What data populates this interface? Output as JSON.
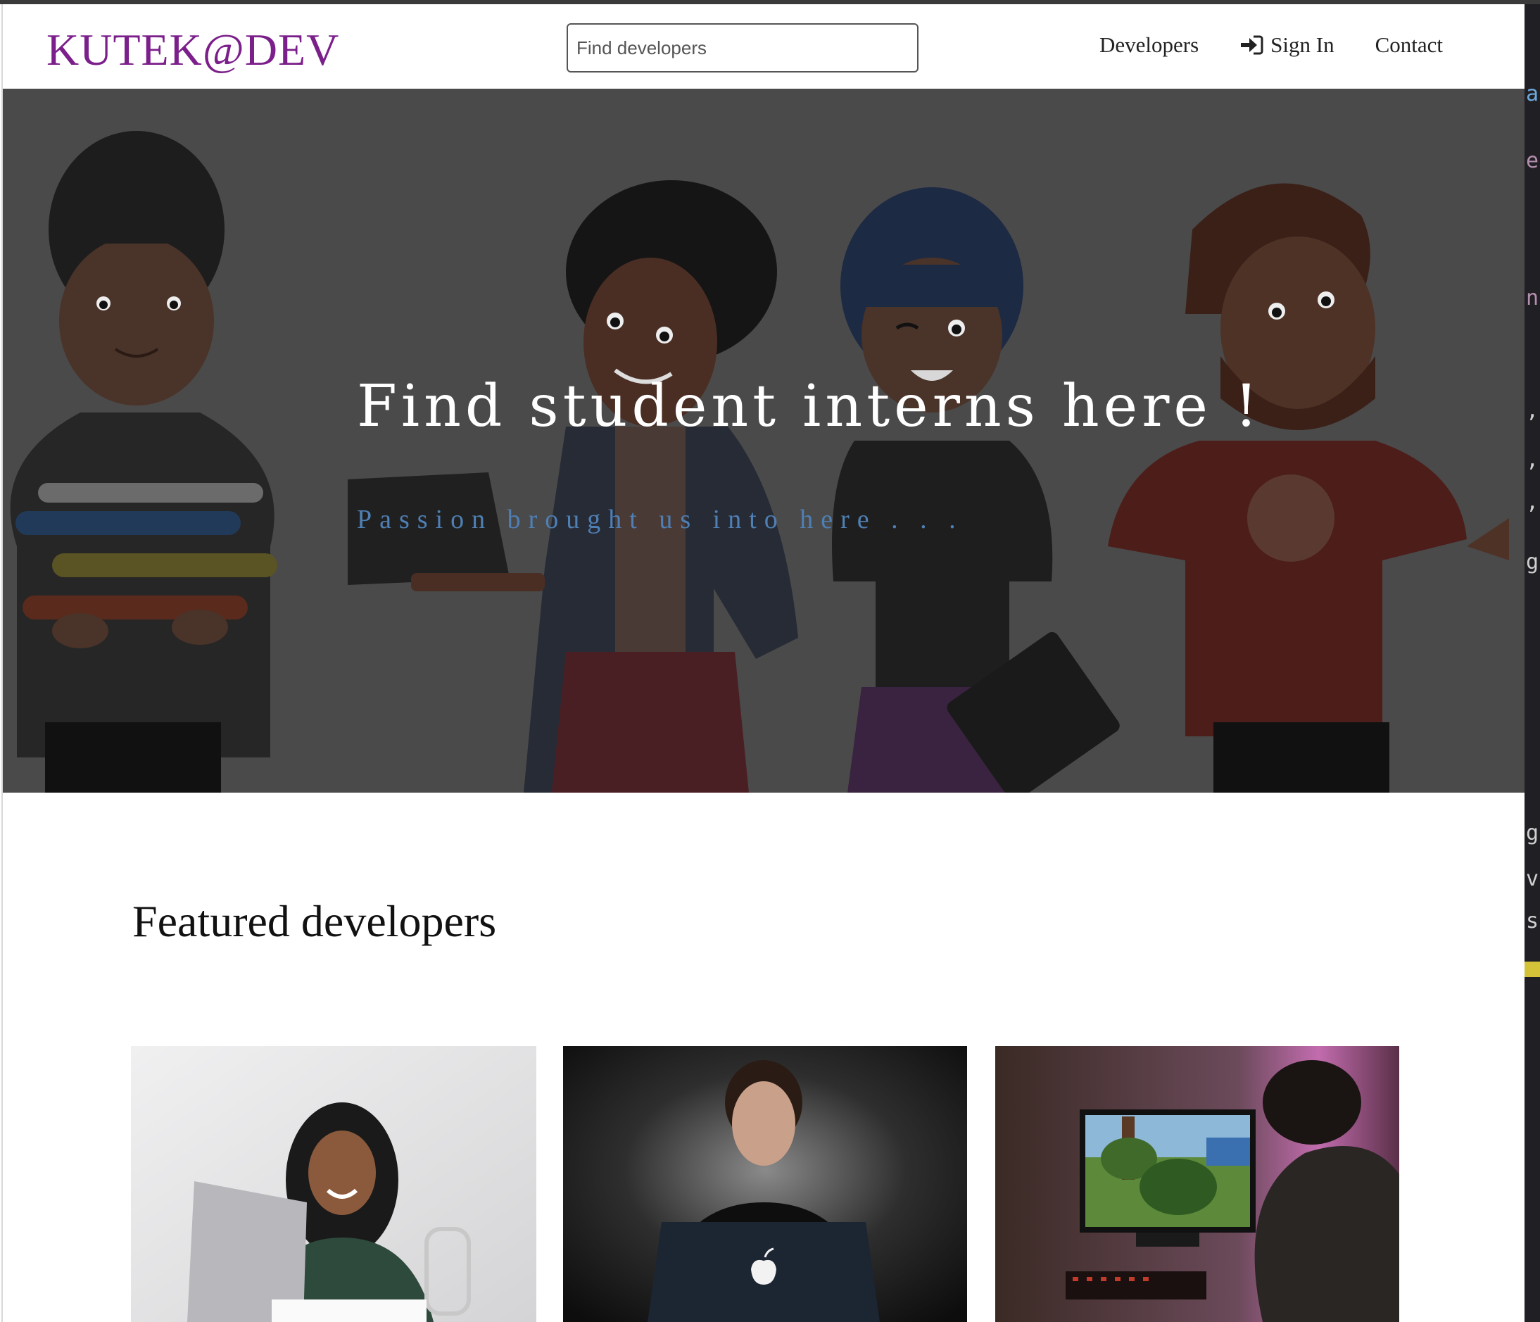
{
  "navbar": {
    "brand": "KUTEK@DEV",
    "search_placeholder": "Find developers",
    "links": [
      {
        "label": "Developers"
      },
      {
        "label": "Sign In",
        "icon": "sign-in-icon"
      },
      {
        "label": "Contact"
      }
    ]
  },
  "hero": {
    "title": "Find student interns here !",
    "subtitle": "Passion brought us into here . . ."
  },
  "featured": {
    "title": "Featured developers",
    "cards": [
      {
        "image": "developer-photo-woman-laptop"
      },
      {
        "image": "developer-photo-man-macbook"
      },
      {
        "image": "developer-photo-gamer-monitor"
      }
    ]
  },
  "colors": {
    "brand": "#7b1f8a",
    "hero_overlay": "#4a4a4a",
    "hero_subtitle": "#4f7fb3"
  }
}
